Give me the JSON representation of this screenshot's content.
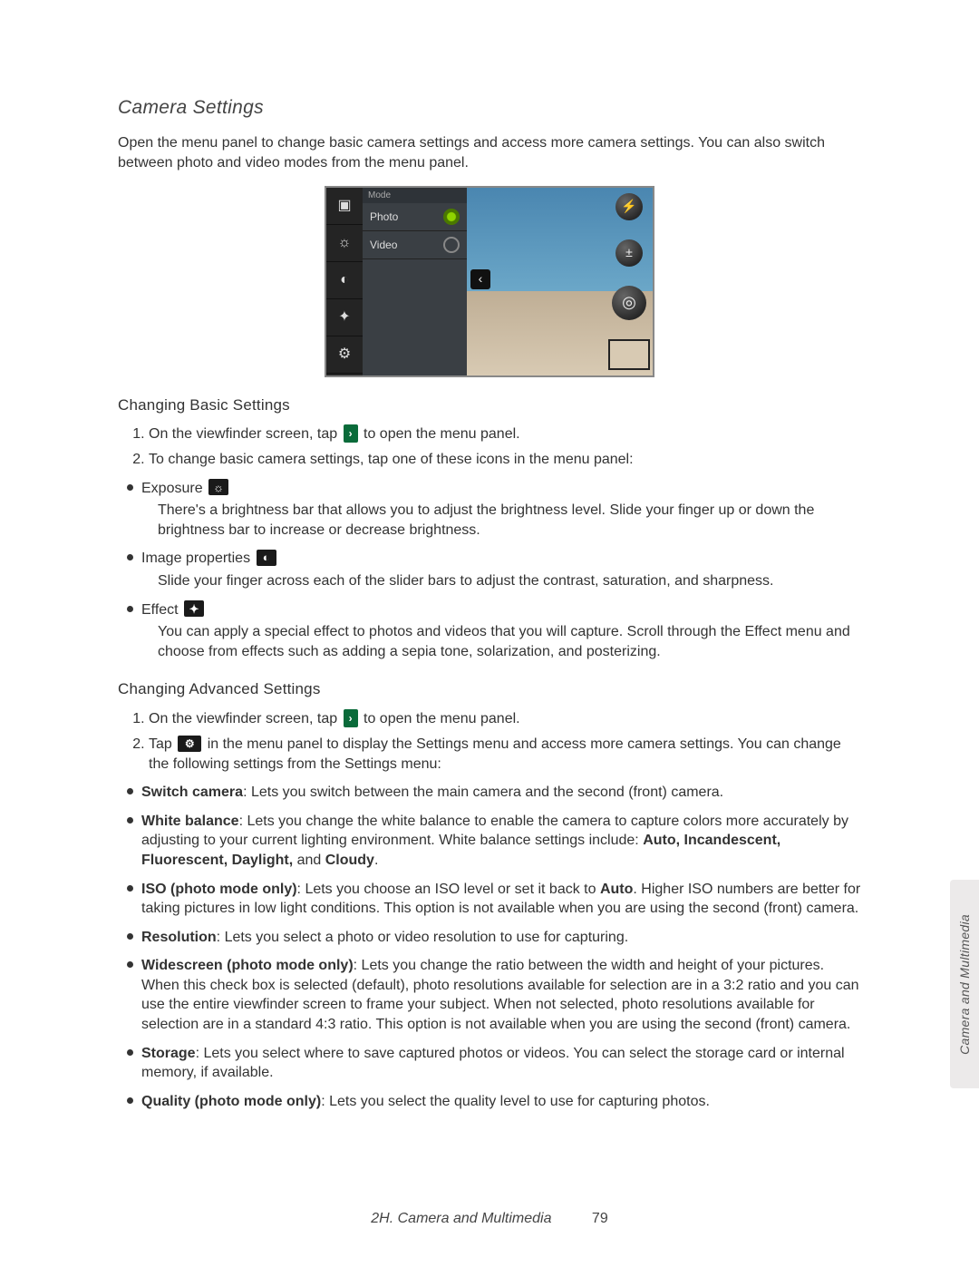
{
  "title": "Camera Settings",
  "intro": "Open the menu panel to change basic camera settings and access more camera settings. You can also switch between photo and video modes from the menu panel.",
  "screenshot": {
    "mode_label": "Mode",
    "mode_photo": "Photo",
    "mode_video": "Video"
  },
  "basic": {
    "heading": "Changing Basic Settings",
    "step1_a": "On the viewfinder screen, tap",
    "step1_b": "to open the menu panel.",
    "step2": "To change basic camera settings, tap one of these icons in the menu panel:",
    "exposure_label": "Exposure",
    "exposure_desc": "There's a brightness bar that allows you to adjust the brightness level. Slide your finger up or down the brightness bar to increase or decrease brightness.",
    "image_props_label": "Image properties",
    "image_props_desc": "Slide your finger across each of the slider bars to adjust the contrast, saturation, and sharpness.",
    "effect_label": "Effect",
    "effect_desc": "You can apply a special effect to photos and videos that you will capture. Scroll through the Effect menu and choose from effects such as adding a sepia tone, solarization, and posterizing."
  },
  "advanced": {
    "heading": "Changing Advanced Settings",
    "step1_a": "On the viewfinder screen, tap",
    "step1_b": "to open the menu panel.",
    "step2_a": "Tap",
    "step2_b": "in the menu panel to display the Settings menu and access more camera settings. You can change the following settings from the Settings menu:",
    "items": {
      "switch_label": "Switch camera",
      "switch_text": ": Lets you switch between the main camera and the second (front) camera.",
      "wb_label": "White balance",
      "wb_text_a": ": Lets you change the white balance to enable the camera to capture colors more accurately by adjusting to your current lighting environment. White balance settings include: ",
      "wb_opts": "Auto, Incandescent, Fluorescent, Daylight,",
      "wb_and": " and ",
      "wb_last": "Cloudy",
      "iso_label": "ISO (photo mode only)",
      "iso_text_a": ": Lets you choose an ISO level or set it back to ",
      "iso_auto": "Auto",
      "iso_text_b": ". Higher ISO numbers are better for taking pictures in low light conditions. This option is not available when you are using the second (front) camera.",
      "res_label": "Resolution",
      "res_text": ": Lets you select a photo or video resolution to use for capturing.",
      "wide_label": "Widescreen (photo mode only)",
      "wide_text": ": Lets you change the ratio between the width and height of your pictures. When this check box is selected (default), photo resolutions available for selection are in a 3:2 ratio and you can use the entire viewfinder screen to frame your subject. When not selected, photo resolutions available for selection are in a standard 4:3 ratio. This option is not available when you are using the second (front) camera.",
      "storage_label": "Storage",
      "storage_text": ": Lets you select where to save captured photos or videos. You can select the storage card or internal memory, if available.",
      "quality_label": "Quality (photo mode only)",
      "quality_text": ": Lets you select the quality level to use for capturing photos."
    }
  },
  "side_tab": "Camera and Multimedia",
  "footer_chapter": "2H. Camera and Multimedia",
  "footer_page": "79"
}
